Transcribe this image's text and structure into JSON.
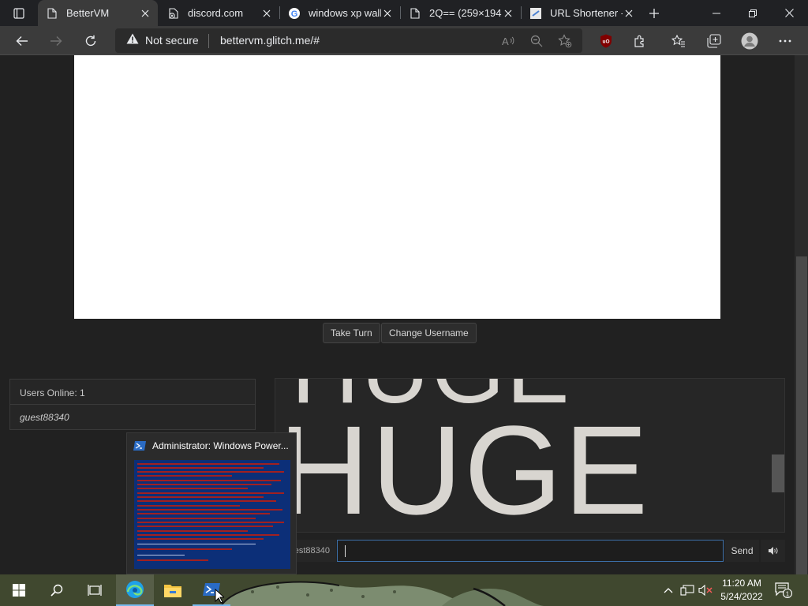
{
  "browser": {
    "tabs": [
      {
        "title": "BetterVM",
        "active": true,
        "icon": "page-icon"
      },
      {
        "title": "discord.com",
        "active": false,
        "icon": "page-warning-icon"
      },
      {
        "title": "windows xp wall",
        "active": false,
        "icon": "google-icon"
      },
      {
        "title": "2Q== (259×194",
        "active": false,
        "icon": "page-icon"
      },
      {
        "title": "URL Shortener -",
        "active": false,
        "icon": "url-shortener-icon"
      }
    ],
    "security_label": "Not secure",
    "url": "bettervm.glitch.me/#"
  },
  "page": {
    "buttons": {
      "take_turn": "Take Turn",
      "change_username": "Change Username"
    },
    "users": {
      "header": "Users Online: 1",
      "list": [
        "guest88340"
      ]
    },
    "chat": {
      "message_text": "HUGE",
      "username_prefix": "est88340",
      "input_value": "",
      "send_label": "Send"
    }
  },
  "preview": {
    "title": "Administrator: Windows Power..."
  },
  "taskbar": {
    "time": "11:20 AM",
    "date": "5/24/2022",
    "notification_count": "1"
  },
  "colors": {
    "browser_bg": "#202124",
    "toolbar_bg": "#3b3b3b",
    "page_bg": "#212121",
    "vm_screen": "#ffffff",
    "chat_input_border": "#3c6fa8",
    "powershell_blue": "#0c2f78"
  }
}
